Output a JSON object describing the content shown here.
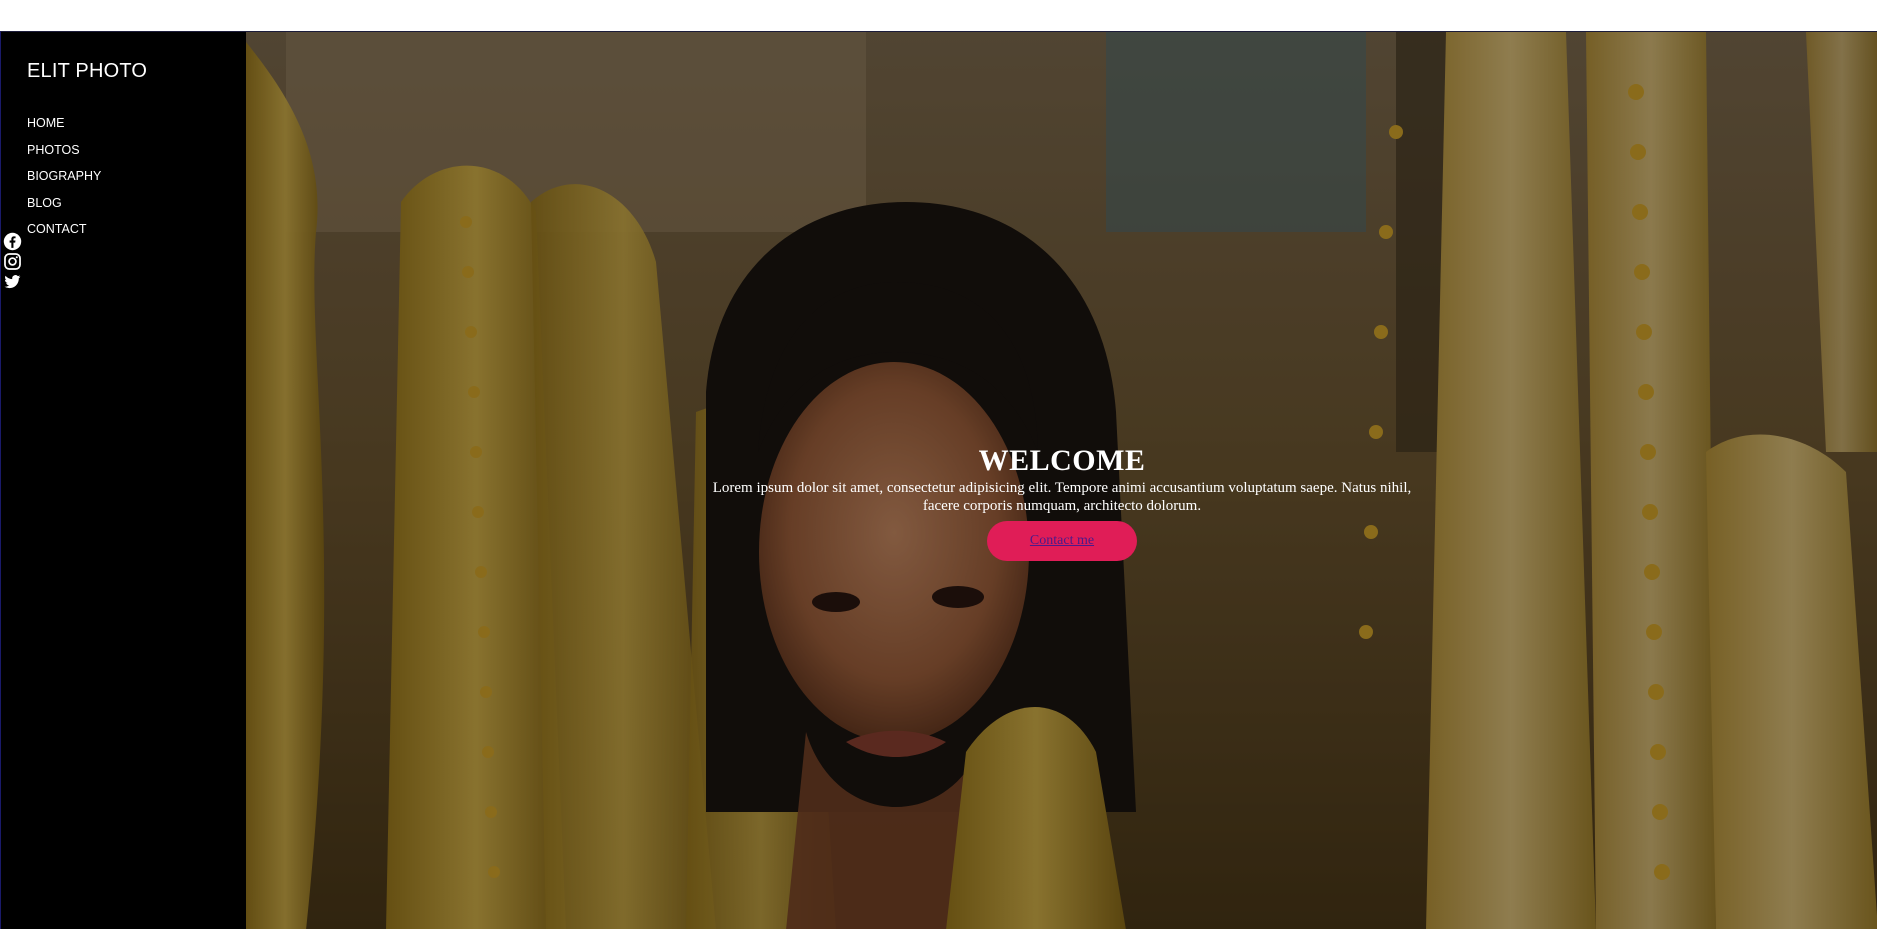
{
  "brand": {
    "logo_text": "ELIT PHOTO"
  },
  "nav": {
    "items": [
      {
        "label": "HOME"
      },
      {
        "label": "PHOTOS"
      },
      {
        "label": "BIOGRAPHY"
      },
      {
        "label": "BLOG"
      },
      {
        "label": "CONTACT"
      }
    ]
  },
  "social": {
    "icons": [
      "facebook-icon",
      "instagram-icon",
      "twitter-icon"
    ]
  },
  "hero": {
    "title": "WELCOME",
    "lead": "Lorem ipsum dolor sit amet, consectetur adipisicing elit. Tempore animi accusantium voluptatum saepe. Natus nihil, facere corporis numquam, architecto dolorum.",
    "cta_label": "Contact me"
  },
  "colors": {
    "sidebar_bg": "#000000",
    "accent": "#e01d57",
    "text": "#ffffff",
    "cta_text": "#4b1a8a"
  }
}
